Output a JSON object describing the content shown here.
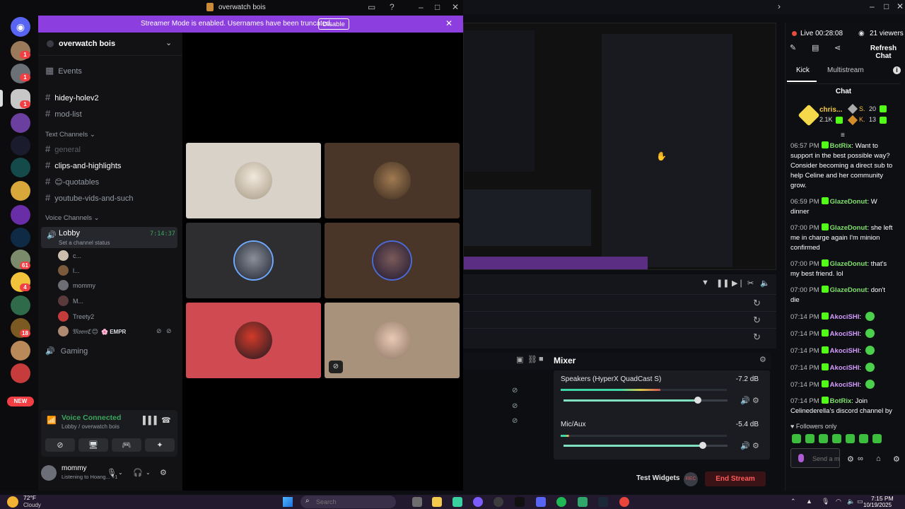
{
  "discord": {
    "window_title": "overwatch bois",
    "banner": {
      "text": "Streamer Mode is enabled. Usernames have been truncated.",
      "button": "Disable"
    },
    "server_name": "overwatch bois",
    "events_label": "Events",
    "channels_top": [
      "hidey-holev2",
      "mod-list"
    ],
    "text_category": "Text Channels",
    "text_channels": [
      "general",
      "clips-and-highlights",
      "😊-quotables",
      "youtube-vids-and-such"
    ],
    "voice_category": "Voice Channels",
    "lobby": {
      "name": "Lobby",
      "timer": "7:14:37",
      "status": "Set a channel status"
    },
    "voice_users": [
      {
        "name": "c..."
      },
      {
        "name": "l..."
      },
      {
        "name": "mommy"
      },
      {
        "name": "M..."
      },
      {
        "name": "Treety2"
      },
      {
        "name": "𝔐𝔬𝔬𝔫ℭ😊",
        "tag": "EMPR"
      }
    ],
    "gaming_channel": "Gaming",
    "voice_connected": {
      "title": "Voice Connected",
      "subtitle": "Lobby / overwatch bois"
    },
    "user": {
      "name": "mommy",
      "activity": "Listening to Hoang... +1"
    },
    "new_badge": "NEW",
    "server_badges": [
      "1",
      "1",
      "1",
      "61",
      "4",
      "18"
    ]
  },
  "stream_app": {
    "mixer_title": "Mixer",
    "mixer": [
      {
        "name": "Speakers (HyperX QuadCast S)",
        "db": "-7.2 dB",
        "level": 0.82
      },
      {
        "name": "Mic/Aux",
        "db": "-5.4 dB",
        "level": 0.85
      }
    ],
    "test_widgets": "Test Widgets",
    "rec_label": "REC",
    "end_stream": "End Stream"
  },
  "chat_panel": {
    "live": "Live 00:28:08",
    "viewers": "21 viewers",
    "refresh": "Refresh Chat",
    "tabs": [
      "Kick",
      "Multistream"
    ],
    "header": "Chat",
    "leader": {
      "name": "chris...",
      "count": "2.1K",
      "s_label": "S.",
      "s_val": "20",
      "k_label": "K.",
      "k_val": "13"
    },
    "messages": [
      {
        "time": "06:57 PM",
        "user": "BotRix",
        "text": "Want to support in the best possible way? Consider becoming a direct sub to help Celine and her community grow."
      },
      {
        "time": "06:59 PM",
        "user": "GlazeDonut",
        "text": "W dinner"
      },
      {
        "time": "07:00 PM",
        "user": "GlazeDonut",
        "text": "she left me in charge again I'm minion confirmed"
      },
      {
        "time": "07:00 PM",
        "user": "GlazeDonut",
        "text": "that's my best friend. lol"
      },
      {
        "time": "07:00 PM",
        "user": "GlazeDonut",
        "text": "don't die"
      },
      {
        "time": "07:14 PM",
        "user": "AkociSHI",
        "text": ""
      },
      {
        "time": "07:14 PM",
        "user": "AkociSHI",
        "text": ""
      },
      {
        "time": "07:14 PM",
        "user": "AkociSHI",
        "text": ""
      },
      {
        "time": "07:14 PM",
        "user": "AkociSHI",
        "text": ""
      },
      {
        "time": "07:14 PM",
        "user": "AkociSHI",
        "text": ""
      },
      {
        "time": "07:14 PM",
        "user": "BotRix",
        "text": "Join Celinederella's discord channel by clicking this link:",
        "link": "https://discord.gg/WRweStcyph"
      }
    ],
    "followers_only": "Followers only",
    "send_placeholder": "Send a message"
  },
  "taskbar": {
    "temp": "72°F",
    "weather": "Cloudy",
    "search_placeholder": "Search",
    "time": "7:15 PM",
    "date": "10/19/2025"
  },
  "colors": {
    "discord_banner": "#8c3fde",
    "kick_green": "#53fc18",
    "end_stream": "#ff5a5a",
    "voice_green": "#3ba55d"
  }
}
